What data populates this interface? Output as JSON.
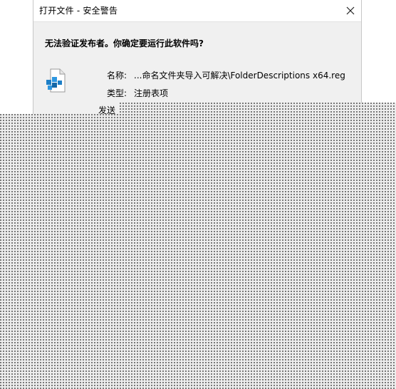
{
  "window": {
    "title": "打开文件 - 安全警告",
    "close_icon": "close-icon"
  },
  "dialog": {
    "question": "无法验证发布者。你确定要运行此软件吗?",
    "file_icon": "registry-file-icon",
    "fields": {
      "name_label": "名称:",
      "name_value": "...命名文件夹导入可解决\\FolderDescriptions x64.reg",
      "type_label": "类型:",
      "type_value": "注册表项",
      "sender_label": "发送"
    }
  },
  "colors": {
    "dialog_bg": "#f0f0f0",
    "titlebar_bg": "#ffffff",
    "icon_blue": "#1d7fc7",
    "dither_dot": "#5a5a5a"
  }
}
